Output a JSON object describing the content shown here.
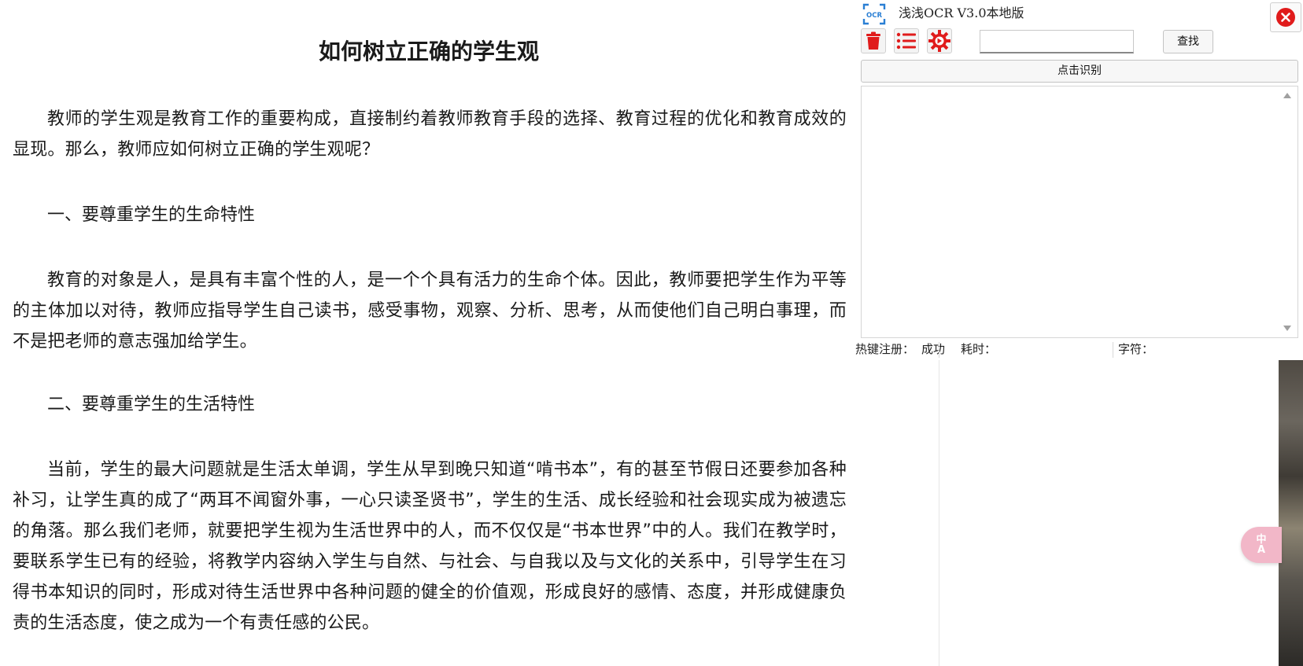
{
  "document": {
    "title": "如何树立正确的学生观",
    "paragraphs": [
      "教师的学生观是教育工作的重要构成，直接制约着教师教育手段的选择、教育过程的优化和教育成效的显现。那么，教师应如何树立正确的学生观呢？",
      "教育的对象是人，是具有丰富个性的人，是一个个具有活力的生命个体。因此，教师要把学生作为平等的主体加以对待，教师应指导学生自己读书，感受事物，观察、分析、思考，从而使他们自己明白事理，而不是把老师的意志强加给学生。",
      "当前，学生的最大问题就是生活太单调，学生从早到晚只知道“啃书本”，有的甚至节假日还要参加各种补习，让学生真的成了“两耳不闻窗外事，一心只读圣贤书”，学生的生活、成长经验和社会现实成为被遗忘的角落。那么我们老师，就要把学生视为生活世界中的人，而不仅仅是“书本世界”中的人。我们在教学时，要联系学生已有的经验，将教学内容纳入学生与自然、与社会、与自我以及与文化的关系中，引导学生在习得书本知识的同时，形成对待生活世界中各种问题的健全的价值观，形成良好的感情、态度，并形成健康负责的生活态度，使之成为一个有责任感的公民。"
    ],
    "headings": [
      "一、要尊重学生的生命特性",
      "二、要尊重学生的生活特性"
    ]
  },
  "ocr_app": {
    "logo_text": "OCR",
    "title": "浅浅OCR V3.0本地版",
    "toolbar": {
      "delete_icon": "trash-icon",
      "list_icon": "list-icon",
      "settings_icon": "gear-icon"
    },
    "search": {
      "value": "",
      "placeholder": ""
    },
    "find_label": "查找",
    "recognize_label": "点击识别",
    "result_text": "",
    "status": {
      "hotkey_label": "热键注册：",
      "hotkey_value": "成功",
      "time_label": "耗时：",
      "chars_label": "字符："
    }
  },
  "overlay": {
    "translate_label_top": "中",
    "translate_label_bottom": "A"
  },
  "colors": {
    "accent_red": "#e01b1b",
    "logo_blue": "#2a7fd4",
    "translate_pink": "#f2b7c8"
  }
}
